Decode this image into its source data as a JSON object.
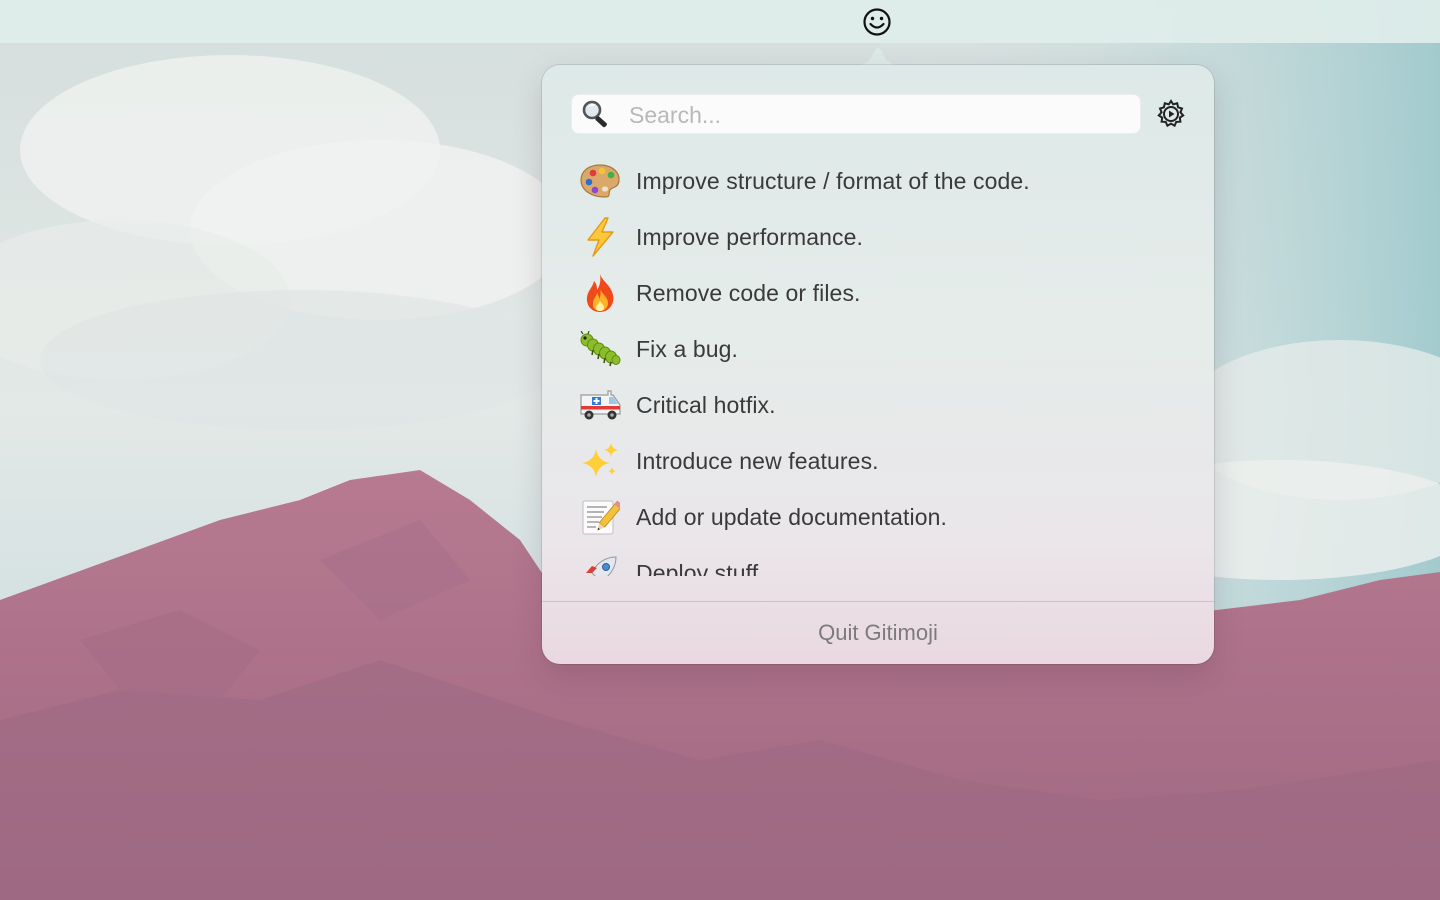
{
  "menubar": {
    "status_icon": "smiley-face-icon"
  },
  "popover": {
    "search": {
      "placeholder": "Search...",
      "value": "",
      "icon": "magnifying-glass-icon"
    },
    "settings_icon": "gear-icon",
    "items": [
      {
        "emoji": "artist-palette-icon",
        "label": "Improve structure / format of the code."
      },
      {
        "emoji": "high-voltage-icon",
        "label": "Improve performance."
      },
      {
        "emoji": "fire-icon",
        "label": "Remove code or files."
      },
      {
        "emoji": "bug-icon",
        "label": "Fix a bug."
      },
      {
        "emoji": "ambulance-icon",
        "label": "Critical hotfix."
      },
      {
        "emoji": "sparkles-icon",
        "label": "Introduce new features."
      },
      {
        "emoji": "memo-icon",
        "label": "Add or update documentation."
      },
      {
        "emoji": "rocket-icon",
        "label": "Deploy stuff."
      }
    ],
    "quit_label": "Quit Gitimoji"
  },
  "colors": {
    "accent_text": "#3a3a3a",
    "quit_text": "#7b7b7b",
    "mountain": "#b57a92"
  }
}
